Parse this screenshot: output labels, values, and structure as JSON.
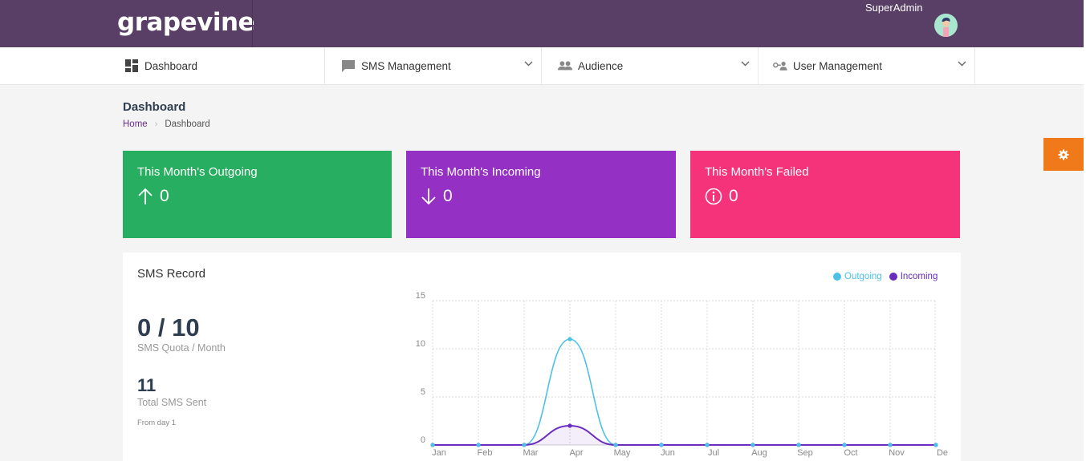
{
  "app": {
    "logo_text": "grapevine",
    "username": "SuperAdmin"
  },
  "nav": {
    "items": [
      {
        "label": "Dashboard",
        "icon": "dashboard-icon",
        "has_dropdown": false
      },
      {
        "label": "SMS Management",
        "icon": "chat-icon",
        "has_dropdown": true
      },
      {
        "label": "Audience",
        "icon": "people-icon",
        "has_dropdown": true
      },
      {
        "label": "User Management",
        "icon": "user-key-icon",
        "has_dropdown": true
      }
    ]
  },
  "page": {
    "title": "Dashboard",
    "breadcrumb": {
      "home": "Home",
      "current": "Dashboard"
    }
  },
  "stats": [
    {
      "label": "This Month's Outgoing",
      "value": "0",
      "icon": "arrow-up-icon",
      "color": "#27ae60"
    },
    {
      "label": "This Month's Incoming",
      "value": "0",
      "icon": "arrow-down-icon",
      "color": "#9530c4"
    },
    {
      "label": "This Month's Failed",
      "value": "0",
      "icon": "info-icon",
      "color": "#f5337a"
    }
  ],
  "colors": {
    "topbar": "#593e66",
    "settings_tab": "#f07a1a",
    "outgoing": "#4dc0ea",
    "incoming": "#6a2bbf"
  },
  "sms_record": {
    "title": "SMS Record",
    "quota_value": "0 / 10",
    "quota_label": "SMS Quota / Month",
    "total_value": "11",
    "total_label": "Total SMS Sent",
    "from_label": "From day 1"
  },
  "chart_data": {
    "type": "line",
    "categories": [
      "Jan",
      "Feb",
      "Mar",
      "Apr",
      "May",
      "Jun",
      "Jul",
      "Aug",
      "Sep",
      "Oct",
      "Nov",
      "De"
    ],
    "series": [
      {
        "name": "Outgoing",
        "values": [
          0,
          0,
          0,
          11,
          0,
          0,
          0,
          0,
          0,
          0,
          0,
          0
        ],
        "color": "#4dc0ea"
      },
      {
        "name": "Incoming",
        "values": [
          0,
          0,
          0,
          2,
          0,
          0,
          0,
          0,
          0,
          0,
          0,
          0
        ],
        "color": "#6a2bbf"
      }
    ],
    "yticks": [
      "0",
      "5",
      "10",
      "15"
    ],
    "ylim": [
      0,
      15
    ],
    "legend_position": "top-right",
    "grid": true
  }
}
